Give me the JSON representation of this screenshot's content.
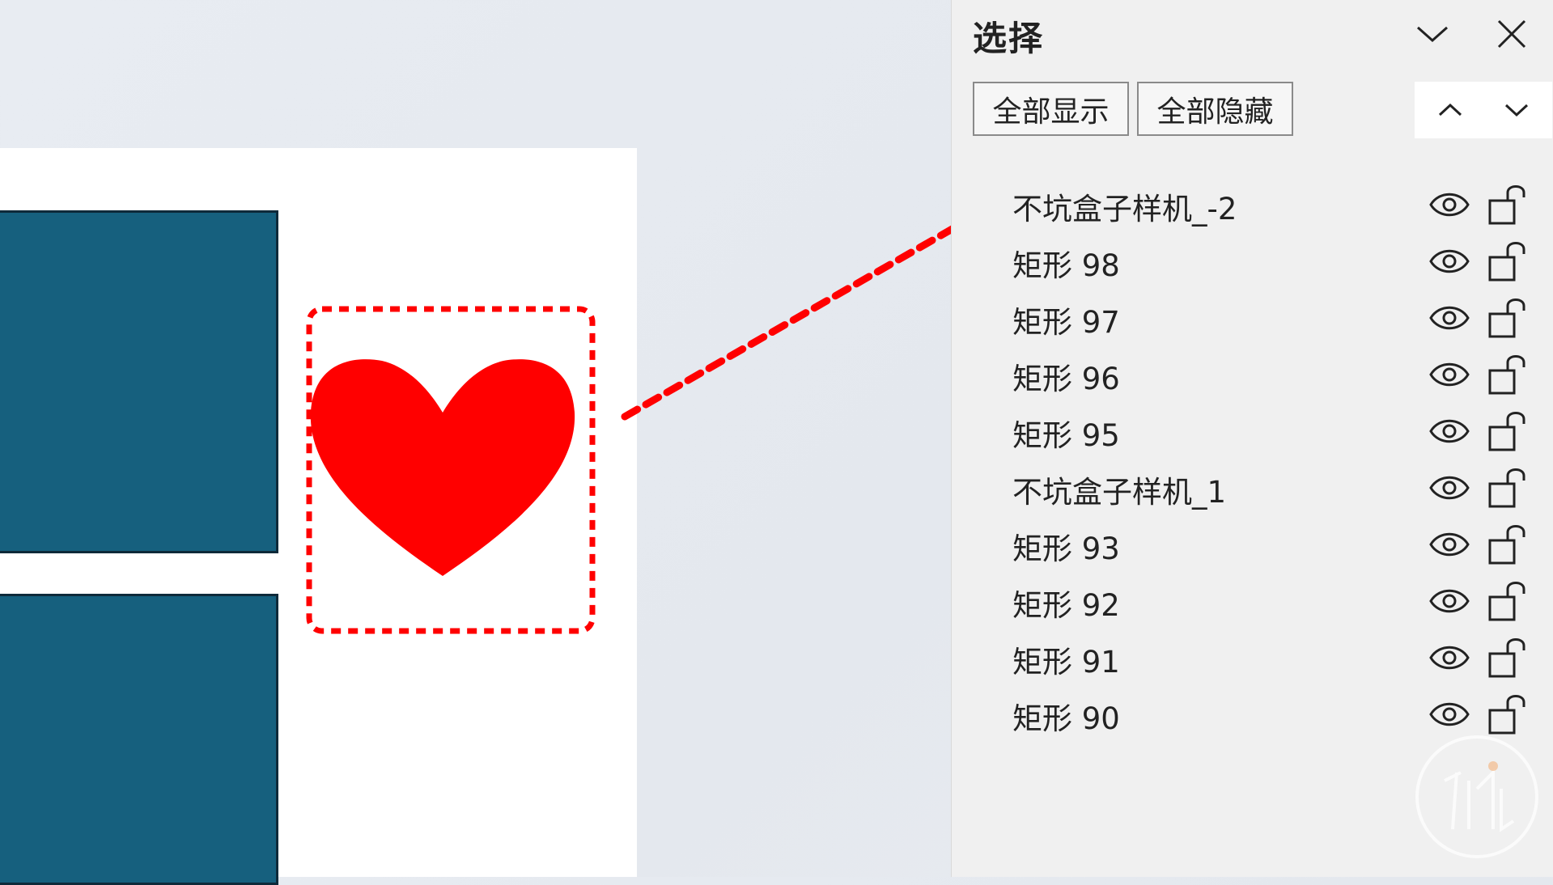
{
  "panel": {
    "title": "选择",
    "collapse_icon": "chevron-down-icon",
    "close_icon": "close-icon",
    "show_all_label": "全部显示",
    "hide_all_label": "全部隐藏",
    "move_up_icon": "chevron-up-icon",
    "move_down_icon": "chevron-down-icon"
  },
  "items": [
    {
      "label": "不坑盒子样机_-2",
      "visible": true,
      "locked": false
    },
    {
      "label": "矩形 98",
      "visible": true,
      "locked": false
    },
    {
      "label": "矩形 97",
      "visible": true,
      "locked": false
    },
    {
      "label": "矩形 96",
      "visible": true,
      "locked": false
    },
    {
      "label": "矩形 95",
      "visible": true,
      "locked": false
    },
    {
      "label": "不坑盒子样机_1",
      "visible": true,
      "locked": false
    },
    {
      "label": "矩形 93",
      "visible": true,
      "locked": false
    },
    {
      "label": "矩形 92",
      "visible": true,
      "locked": false
    },
    {
      "label": "矩形 91",
      "visible": true,
      "locked": false
    },
    {
      "label": "矩形 90",
      "visible": true,
      "locked": false
    }
  ],
  "colors": {
    "heart": "#ff0000",
    "rect_fill": "#16607e",
    "annotation": "#ff0000",
    "panel_bg": "#f0f0f0"
  }
}
